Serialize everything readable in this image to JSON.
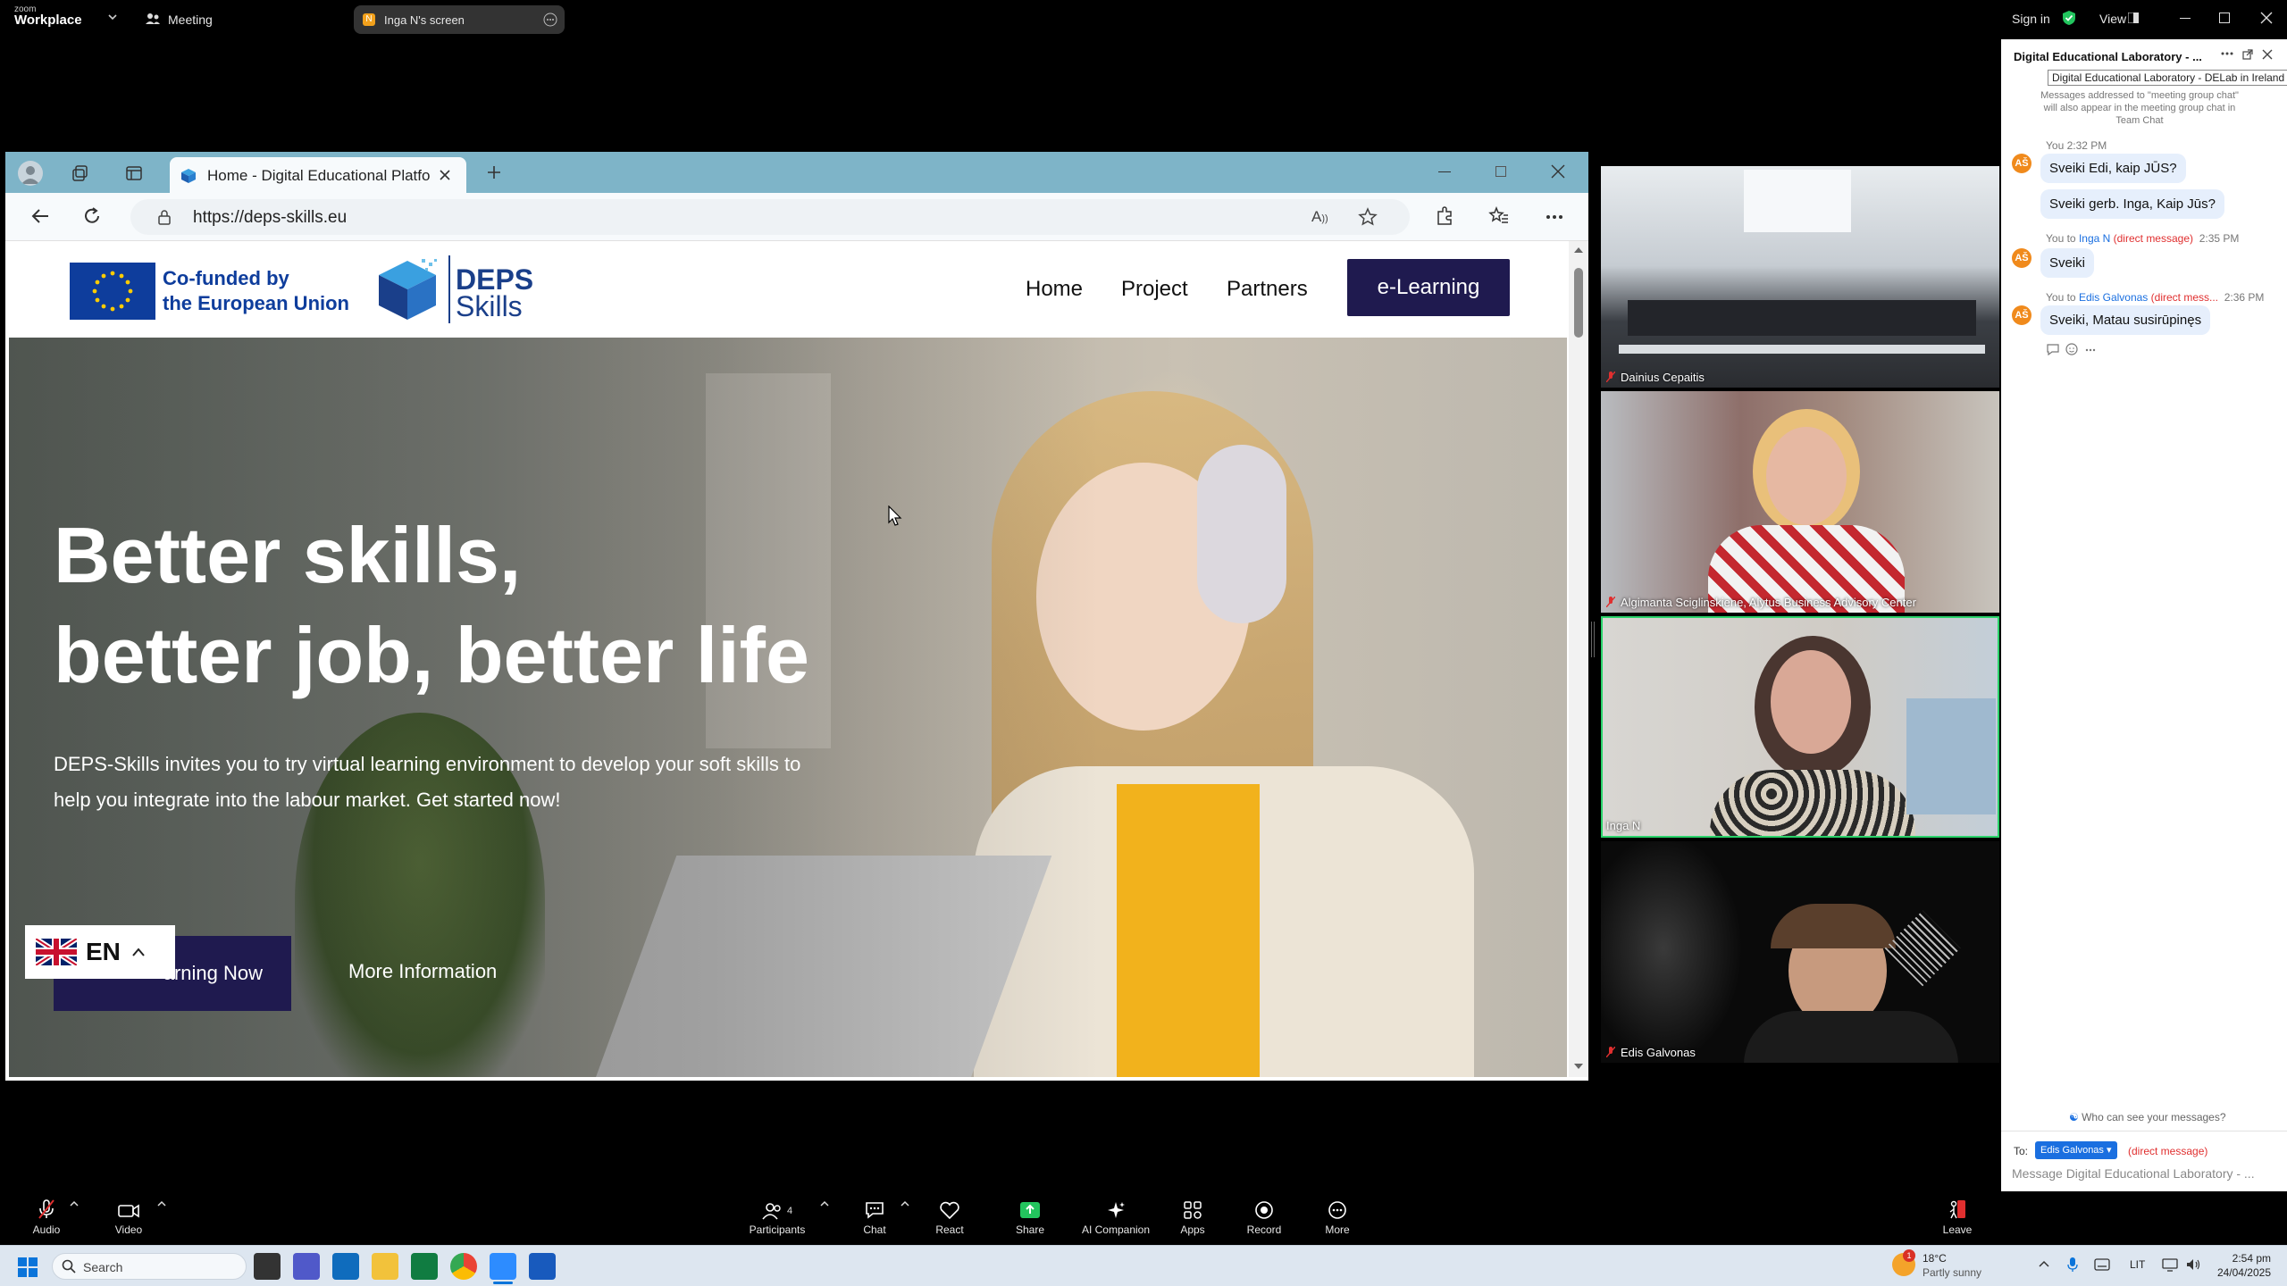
{
  "topbar": {
    "brand_small": "zoom",
    "brand": "Workplace",
    "meeting_label": "Meeting",
    "share_label": "Inga N's screen",
    "sign_in": "Sign in",
    "view": "View"
  },
  "browser": {
    "tab_title": "Home - Digital Educational Platfo",
    "url": "https://deps-skills.eu"
  },
  "site": {
    "eu_line1": "Co-funded by",
    "eu_line2": "the European Union",
    "logo_top": "DEPS",
    "logo_bottom": "Skills",
    "nav": [
      "Home",
      "Project",
      "Partners"
    ],
    "cta": "e-Learning",
    "hero_line1": "Better skills,",
    "hero_line2": "better job, better life",
    "hero_body1": "DEPS-Skills invites you to try virtual learning environment to develop your soft skills to",
    "hero_body2": "help you integrate into the labour market. Get started now!",
    "btn_primary": "arning Now",
    "btn_secondary": "More Information",
    "lang": "EN"
  },
  "participants": [
    {
      "name": "Dainius Cepaitis"
    },
    {
      "name": "Algimanta Sciglinskiene, Alytus Business Advisory Center"
    },
    {
      "name": "Inga N"
    },
    {
      "name": "Edis Galvonas"
    }
  ],
  "chat": {
    "title": "Digital Educational Laboratory - ...",
    "tooltip": "Digital Educational Laboratory - DELab in Ireland",
    "notice1": "Messages addressed to \"meeting group chat\"",
    "notice2": "will also appear in the meeting group chat in",
    "notice3": "Team Chat",
    "avatar": "AŠ",
    "msg1_meta": "You 2:32 PM",
    "msg1": "Sveiki Edi, kaip JŪS?",
    "msg2": "Sveiki gerb. Inga, Kaip Jūs?",
    "msg3_meta_prefix": "You to",
    "msg3_to": "Inga N",
    "msg3_dm": "(direct message)",
    "msg3_time": "2:35 PM",
    "msg3": "Sveiki",
    "msg4_meta_prefix": "You to",
    "msg4_to": "Edis Galvonas",
    "msg4_dm": "(direct mess...",
    "msg4_time": "2:36 PM",
    "msg4": "Sveiki, Matau susirūpinęs",
    "who_can_see": "Who can see your messages?",
    "to_label": "To:",
    "to_value": "Edis Galvonas",
    "to_dm": "(direct message)",
    "input_placeholder": "Message Digital Educational Laboratory - ..."
  },
  "toolbar": {
    "audio": "Audio",
    "video": "Video",
    "participants": "Participants",
    "participants_count": "4",
    "chat": "Chat",
    "react": "React",
    "share": "Share",
    "ai": "AI Companion",
    "apps": "Apps",
    "record": "Record",
    "more": "More",
    "leave": "Leave"
  },
  "taskbar": {
    "search": "Search",
    "weather_temp": "18°C",
    "weather_desc": "Partly sunny",
    "weather_badge": "1",
    "lang": "LIT",
    "time": "2:54 pm",
    "date": "24/04/2025"
  }
}
